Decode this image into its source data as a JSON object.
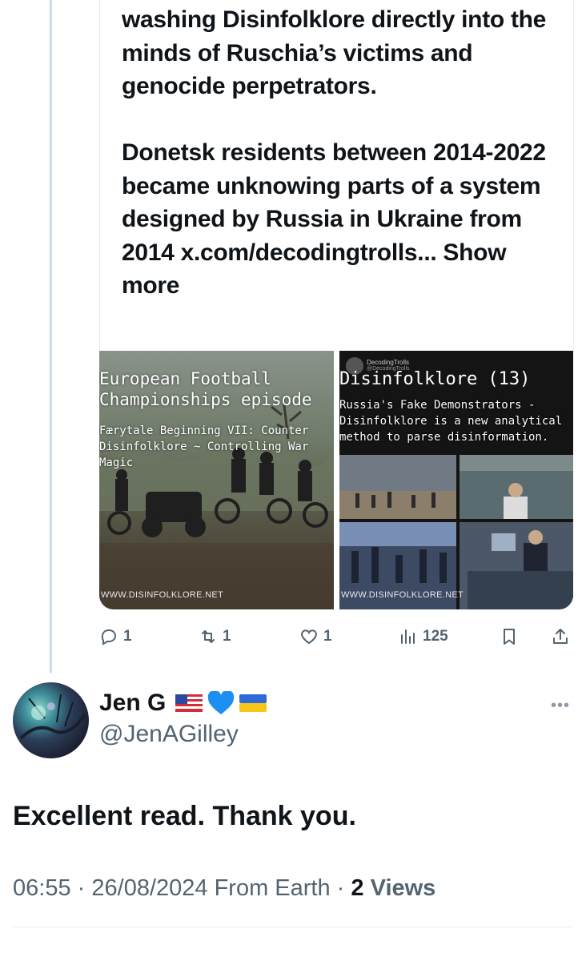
{
  "quoted_post": {
    "paragraph_1": "washing Disinfolklore directly into the minds of Ruschia’s victims and genocide perpetrators.",
    "paragraph_2": "Donetsk residents between 2014-2022 became unknowing parts of a system designed by Russia in Ukraine from 2014 x.com/decodingtrolls... Show more",
    "media": [
      {
        "title": "European Football Championships episode",
        "subtitle": "Færytale Beginning VII: Counter Disinfolklore ~ Controlling War Magic",
        "watermark": "WWW.DISINFOLKLORE.NET"
      },
      {
        "title": "Disinfolklore (13)",
        "subtitle": "Russia's Fake Demonstrators - Disinfolklore is a new analytical method to parse disinformation.",
        "embedded_brand": "DecodingTrolls",
        "embedded_handle": "@DecodingTrolls",
        "watermark": "WWW.DISINFOLKLORE.NET"
      }
    ],
    "actions": {
      "replies": "1",
      "reposts": "1",
      "likes": "1",
      "views": "125"
    }
  },
  "reply_post": {
    "display_name": "Jen G",
    "badges": [
      "us-flag-icon",
      "blue-heart-icon",
      "ukraine-flag-icon"
    ],
    "handle": "@JenAGilley",
    "text": "Excellent read. Thank you.",
    "time": "06:55",
    "date": "26/08/2024",
    "source": "From Earth",
    "views_count": "2",
    "views_label": "Views",
    "separator": "·"
  },
  "colors": {
    "text": "#0f1419",
    "secondary": "#536471",
    "border": "#e6ecf0"
  }
}
